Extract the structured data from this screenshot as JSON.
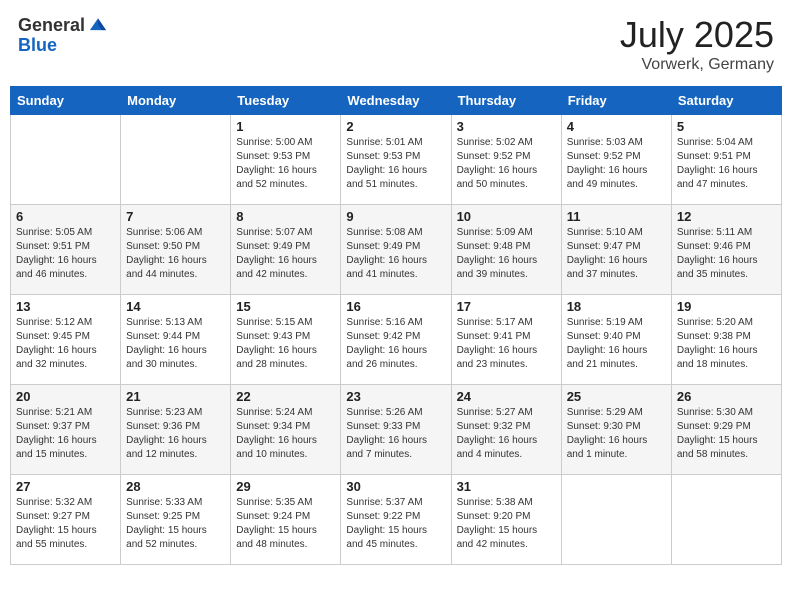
{
  "header": {
    "logo_general": "General",
    "logo_blue": "Blue",
    "month": "July 2025",
    "location": "Vorwerk, Germany"
  },
  "weekdays": [
    "Sunday",
    "Monday",
    "Tuesday",
    "Wednesday",
    "Thursday",
    "Friday",
    "Saturday"
  ],
  "weeks": [
    [
      {
        "day": "",
        "info": ""
      },
      {
        "day": "",
        "info": ""
      },
      {
        "day": "1",
        "info": "Sunrise: 5:00 AM\nSunset: 9:53 PM\nDaylight: 16 hours\nand 52 minutes."
      },
      {
        "day": "2",
        "info": "Sunrise: 5:01 AM\nSunset: 9:53 PM\nDaylight: 16 hours\nand 51 minutes."
      },
      {
        "day": "3",
        "info": "Sunrise: 5:02 AM\nSunset: 9:52 PM\nDaylight: 16 hours\nand 50 minutes."
      },
      {
        "day": "4",
        "info": "Sunrise: 5:03 AM\nSunset: 9:52 PM\nDaylight: 16 hours\nand 49 minutes."
      },
      {
        "day": "5",
        "info": "Sunrise: 5:04 AM\nSunset: 9:51 PM\nDaylight: 16 hours\nand 47 minutes."
      }
    ],
    [
      {
        "day": "6",
        "info": "Sunrise: 5:05 AM\nSunset: 9:51 PM\nDaylight: 16 hours\nand 46 minutes."
      },
      {
        "day": "7",
        "info": "Sunrise: 5:06 AM\nSunset: 9:50 PM\nDaylight: 16 hours\nand 44 minutes."
      },
      {
        "day": "8",
        "info": "Sunrise: 5:07 AM\nSunset: 9:49 PM\nDaylight: 16 hours\nand 42 minutes."
      },
      {
        "day": "9",
        "info": "Sunrise: 5:08 AM\nSunset: 9:49 PM\nDaylight: 16 hours\nand 41 minutes."
      },
      {
        "day": "10",
        "info": "Sunrise: 5:09 AM\nSunset: 9:48 PM\nDaylight: 16 hours\nand 39 minutes."
      },
      {
        "day": "11",
        "info": "Sunrise: 5:10 AM\nSunset: 9:47 PM\nDaylight: 16 hours\nand 37 minutes."
      },
      {
        "day": "12",
        "info": "Sunrise: 5:11 AM\nSunset: 9:46 PM\nDaylight: 16 hours\nand 35 minutes."
      }
    ],
    [
      {
        "day": "13",
        "info": "Sunrise: 5:12 AM\nSunset: 9:45 PM\nDaylight: 16 hours\nand 32 minutes."
      },
      {
        "day": "14",
        "info": "Sunrise: 5:13 AM\nSunset: 9:44 PM\nDaylight: 16 hours\nand 30 minutes."
      },
      {
        "day": "15",
        "info": "Sunrise: 5:15 AM\nSunset: 9:43 PM\nDaylight: 16 hours\nand 28 minutes."
      },
      {
        "day": "16",
        "info": "Sunrise: 5:16 AM\nSunset: 9:42 PM\nDaylight: 16 hours\nand 26 minutes."
      },
      {
        "day": "17",
        "info": "Sunrise: 5:17 AM\nSunset: 9:41 PM\nDaylight: 16 hours\nand 23 minutes."
      },
      {
        "day": "18",
        "info": "Sunrise: 5:19 AM\nSunset: 9:40 PM\nDaylight: 16 hours\nand 21 minutes."
      },
      {
        "day": "19",
        "info": "Sunrise: 5:20 AM\nSunset: 9:38 PM\nDaylight: 16 hours\nand 18 minutes."
      }
    ],
    [
      {
        "day": "20",
        "info": "Sunrise: 5:21 AM\nSunset: 9:37 PM\nDaylight: 16 hours\nand 15 minutes."
      },
      {
        "day": "21",
        "info": "Sunrise: 5:23 AM\nSunset: 9:36 PM\nDaylight: 16 hours\nand 12 minutes."
      },
      {
        "day": "22",
        "info": "Sunrise: 5:24 AM\nSunset: 9:34 PM\nDaylight: 16 hours\nand 10 minutes."
      },
      {
        "day": "23",
        "info": "Sunrise: 5:26 AM\nSunset: 9:33 PM\nDaylight: 16 hours\nand 7 minutes."
      },
      {
        "day": "24",
        "info": "Sunrise: 5:27 AM\nSunset: 9:32 PM\nDaylight: 16 hours\nand 4 minutes."
      },
      {
        "day": "25",
        "info": "Sunrise: 5:29 AM\nSunset: 9:30 PM\nDaylight: 16 hours\nand 1 minute."
      },
      {
        "day": "26",
        "info": "Sunrise: 5:30 AM\nSunset: 9:29 PM\nDaylight: 15 hours\nand 58 minutes."
      }
    ],
    [
      {
        "day": "27",
        "info": "Sunrise: 5:32 AM\nSunset: 9:27 PM\nDaylight: 15 hours\nand 55 minutes."
      },
      {
        "day": "28",
        "info": "Sunrise: 5:33 AM\nSunset: 9:25 PM\nDaylight: 15 hours\nand 52 minutes."
      },
      {
        "day": "29",
        "info": "Sunrise: 5:35 AM\nSunset: 9:24 PM\nDaylight: 15 hours\nand 48 minutes."
      },
      {
        "day": "30",
        "info": "Sunrise: 5:37 AM\nSunset: 9:22 PM\nDaylight: 15 hours\nand 45 minutes."
      },
      {
        "day": "31",
        "info": "Sunrise: 5:38 AM\nSunset: 9:20 PM\nDaylight: 15 hours\nand 42 minutes."
      },
      {
        "day": "",
        "info": ""
      },
      {
        "day": "",
        "info": ""
      }
    ]
  ]
}
